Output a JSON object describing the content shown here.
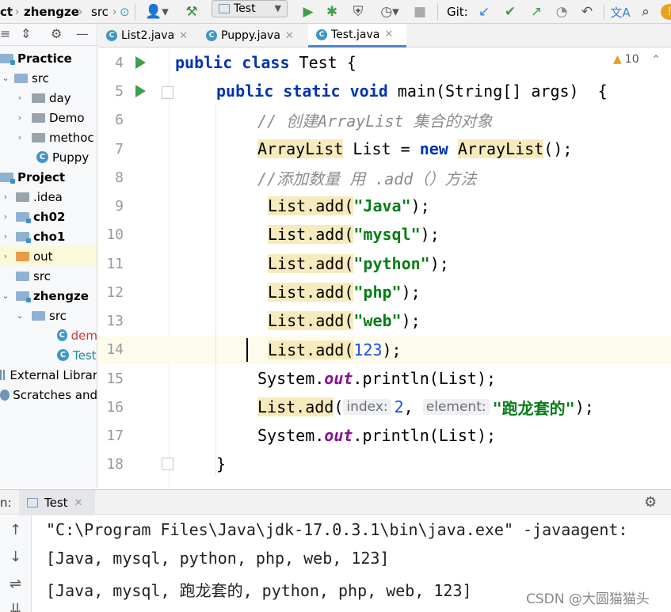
{
  "toolbar": {
    "project_label": "ct",
    "module_label": "zhengze",
    "folder_label": "src",
    "run_config": "Test",
    "git_label": "Git:"
  },
  "sidebar": {
    "items": [
      {
        "label": "Practice",
        "bold": true
      },
      {
        "label": "src"
      },
      {
        "label": "day"
      },
      {
        "label": "Demo"
      },
      {
        "label": "methoc"
      },
      {
        "label": "Puppy"
      },
      {
        "label": "Project",
        "bold": true
      },
      {
        "label": ".idea"
      },
      {
        "label": "ch02",
        "bold": true
      },
      {
        "label": "cho1",
        "bold": true
      },
      {
        "label": "out"
      },
      {
        "label": "src"
      },
      {
        "label": "zhengze",
        "bold": true
      },
      {
        "label": "src"
      },
      {
        "label": "dem"
      },
      {
        "label": "Test"
      },
      {
        "label": "External Librar"
      },
      {
        "label": "Scratches and"
      }
    ]
  },
  "tabs": [
    {
      "label": "List2.java",
      "active": false
    },
    {
      "label": "Puppy.java",
      "active": false
    },
    {
      "label": "Test.java",
      "active": true
    }
  ],
  "editor": {
    "warnings": "10",
    "line_numbers": [
      "4",
      "5",
      "6",
      "7",
      "8",
      "9",
      "10",
      "11",
      "12",
      "13",
      "14",
      "15",
      "16",
      "17",
      "18"
    ],
    "code": {
      "l4_kw1": "public",
      "l4_kw2": "class",
      "l4_rest": " Test {",
      "l5_kw1": "public",
      "l5_kw2": "static",
      "l5_kw3": "void",
      "l5_rest": " main(String[] args)  {",
      "l6": "// 创建ArrayList 集合的对象",
      "l7_type": "ArrayList",
      "l7_mid": " List = ",
      "l7_new": "new",
      "l7_type2": "ArrayList",
      "l7_end": "();",
      "l8": "//添加数量 用 .add（）方法",
      "add_call": "List.add(",
      "end": ");",
      "strings": [
        "\"Java\"",
        "\"mysql\"",
        "\"python\"",
        "\"php\"",
        "\"web\""
      ],
      "l14_num": "123",
      "l15_pre": "System.",
      "l15_out": "out",
      "l15_post": ".println(List);",
      "l16_call": "List.add",
      "l16_paren": "(",
      "l16_hint1": "index:",
      "l16_num": "2",
      "l16_comma": ",",
      "l16_hint2": "element:",
      "l16_str": "\"跑龙套的\"",
      "l16_end": ");",
      "l17_pre": "System.",
      "l17_out": "out",
      "l17_post": ".println(List);",
      "l18": "}"
    }
  },
  "run_panel": {
    "label": "n:",
    "tab": "Test",
    "output": [
      "\"C:\\Program Files\\Java\\jdk-17.0.3.1\\bin\\java.exe\" -javaagent:",
      "[Java, mysql, python, php, web, 123]",
      "[Java, mysql, 跑龙套的, python, php, web, 123]"
    ]
  },
  "watermark": "CSDN @大圆猫猫头"
}
